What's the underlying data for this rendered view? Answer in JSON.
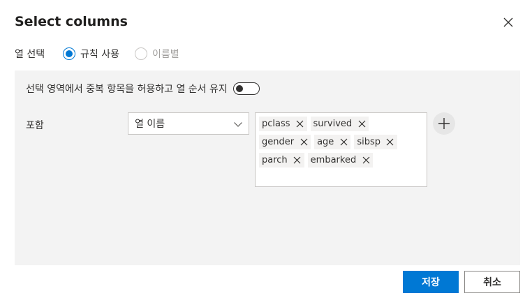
{
  "dialog": {
    "title": "Select columns"
  },
  "column_select": {
    "label": "열 선택",
    "options": [
      {
        "label": "규칙 사용",
        "selected": true,
        "disabled": false
      },
      {
        "label": "이름별",
        "selected": false,
        "disabled": true
      }
    ]
  },
  "panel": {
    "allow_duplicates_label": "선택 영역에서 중복 항목을 허용하고 열 순서 유지",
    "allow_duplicates_on": false,
    "include_label": "포함",
    "criteria_dropdown": {
      "value": "열 이름"
    },
    "tags": [
      "pclass",
      "survived",
      "gender",
      "age",
      "sibsp",
      "parch",
      "embarked"
    ]
  },
  "footer": {
    "save_label": "저장",
    "cancel_label": "취소"
  },
  "colors": {
    "accent": "#0078d4",
    "panel_bg": "#f3f3f3",
    "tag_bg": "#f3f2f1"
  },
  "icons": {
    "close": "close-icon",
    "chevron": "chevron-down-icon",
    "tag_remove": "close-icon",
    "add": "plus-icon"
  }
}
